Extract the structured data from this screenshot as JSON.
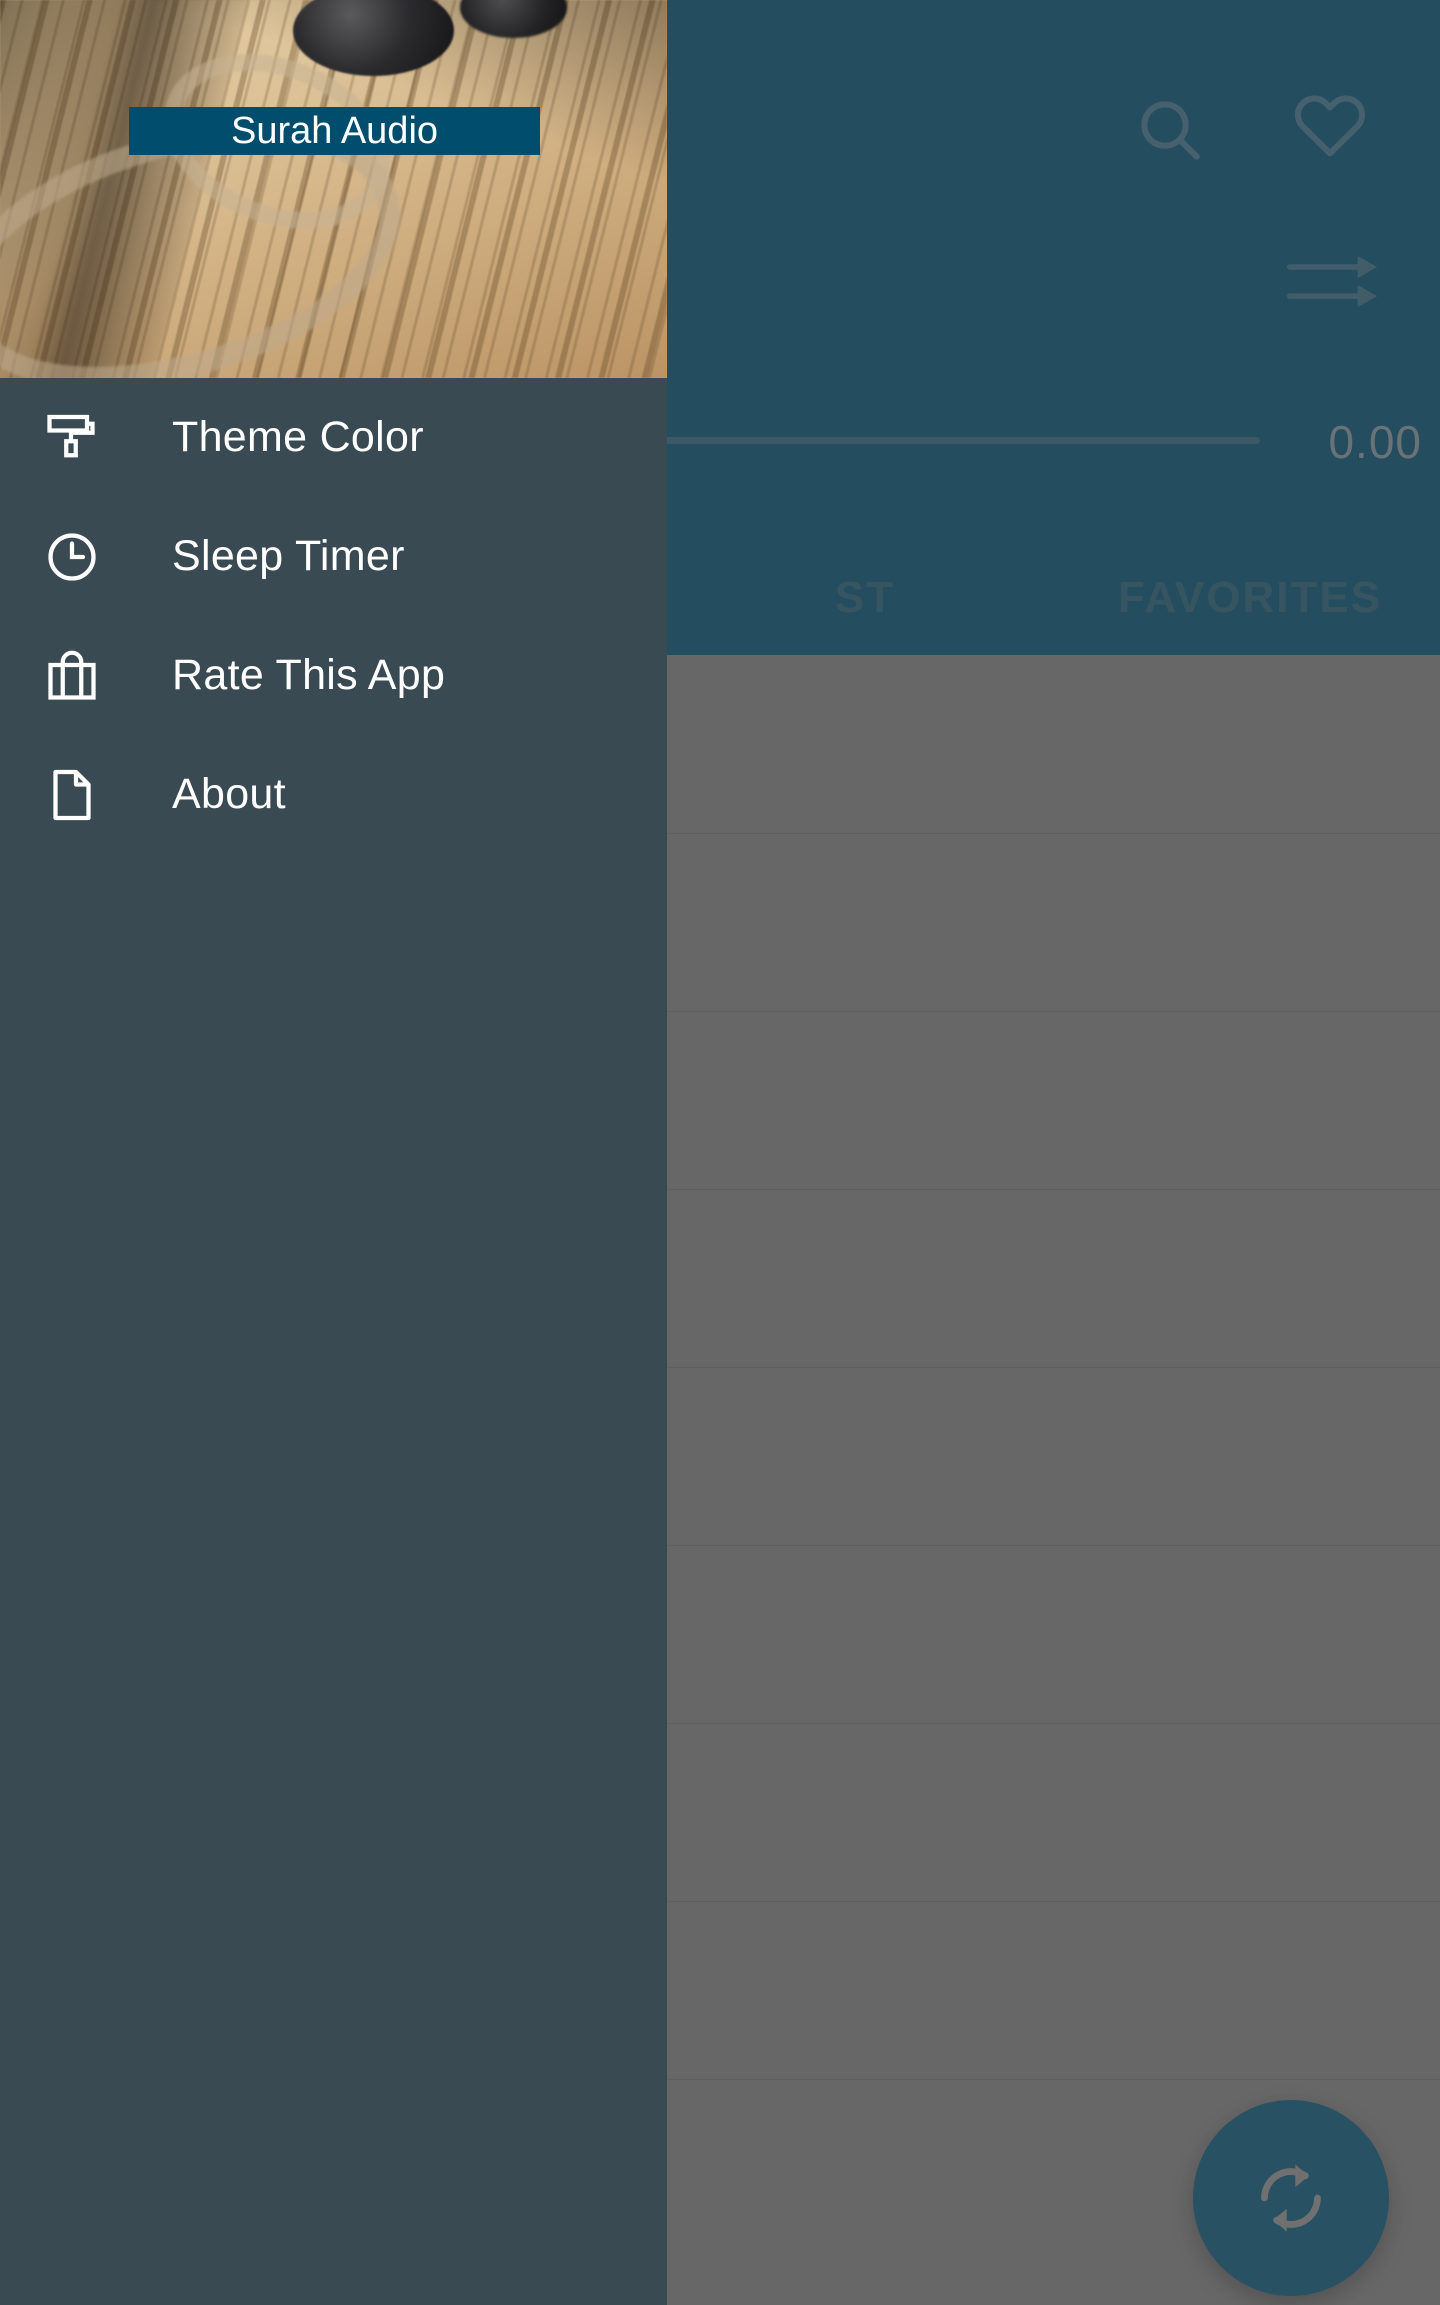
{
  "app": {
    "title": "Surah Audio",
    "accent_color": "#004d6e",
    "drawer_color": "#3a4a52",
    "fab_color": "#0a5276",
    "scrim_color": "#6e6e6e"
  },
  "appbar": {
    "icons": [
      {
        "name": "search-icon",
        "label": "Search"
      },
      {
        "name": "heart-icon",
        "label": "Favorite"
      },
      {
        "name": "forward-icon",
        "label": "Forward"
      }
    ],
    "player": {
      "current_time": "0.00",
      "progress_percent": 0
    },
    "tabs": [
      {
        "label": "SURAH LIST",
        "visible_text": "ST",
        "selected": false
      },
      {
        "label": "FAVORITES",
        "visible_text": "FAVORITES",
        "selected": false
      }
    ]
  },
  "drawer": {
    "header_title": "Surah Audio",
    "items": [
      {
        "label": "Theme Color",
        "icon": "paint-roller-icon"
      },
      {
        "label": "Sleep Timer",
        "icon": "clock-icon"
      },
      {
        "label": "Rate This App",
        "icon": "shopping-bag-icon"
      },
      {
        "label": "About",
        "icon": "document-icon"
      }
    ]
  },
  "fab": {
    "icon": "sync-icon",
    "label": "Repeat"
  }
}
